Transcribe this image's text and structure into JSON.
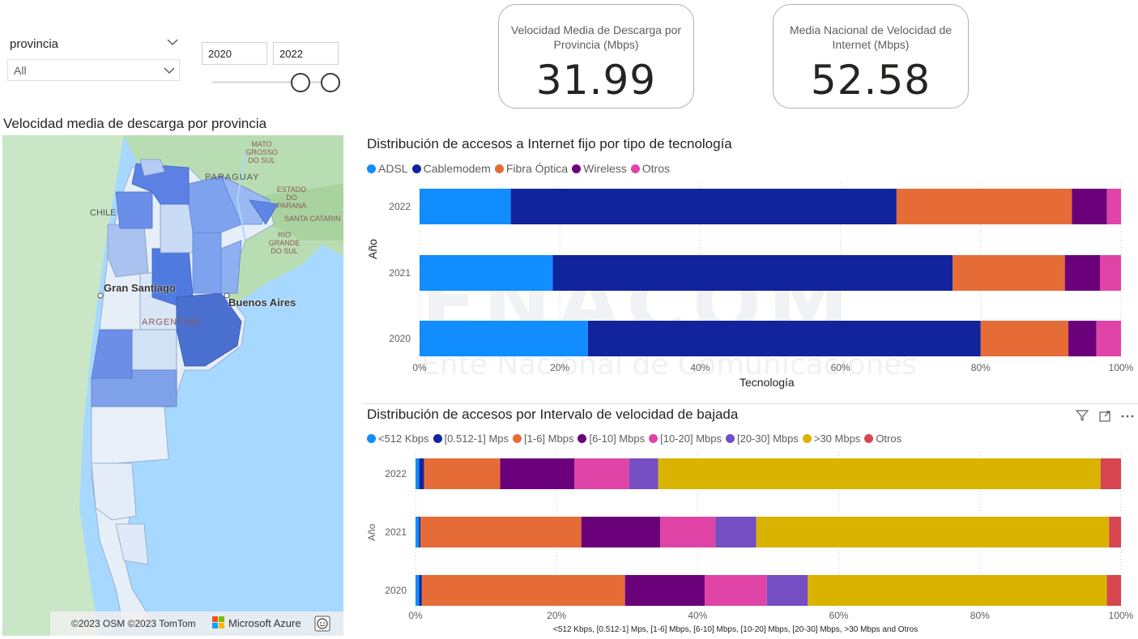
{
  "slicer": {
    "title": "provincia",
    "selected": "All",
    "date_from": "2020",
    "date_to": "2022"
  },
  "cards": [
    {
      "label": "Velocidad Media de Descarga por Provincia (Mbps)",
      "value": "31.99"
    },
    {
      "label": "Media Nacional de Velocidad de Internet (Mbps)",
      "value": "52.58"
    }
  ],
  "map": {
    "title": "Velocidad media de descarga por provincia",
    "labels": {
      "chile": "CHILE",
      "paraguay": "PARAGUAY",
      "gran_santiago": "Gran Santiago",
      "buenos_aires": "Buenos Aires",
      "argentina": "ARGENTINA",
      "grosso": "MATO GROSSO DO SUL",
      "parana": "ESTADO DO PARANÁ",
      "santa_catarina": "SANTA CATARIN",
      "rio_grande": "RIO GRANDE DO SUL"
    },
    "attribution": "©2023 OSM  ©2023 TomTom",
    "brand": "Microsoft Azure"
  },
  "watermark": {
    "line1": "ENACOM",
    "line2": "Ente Nacional de Comunicaciones"
  },
  "chart_data": [
    {
      "type": "bar",
      "orientation": "horizontal-stacked-100",
      "title": "Distribución de accesos a Internet fijo por tipo de tecnología",
      "xlabel": "Tecnología",
      "ylabel": "Año",
      "categories": [
        "2022",
        "2021",
        "2020"
      ],
      "x_ticks": [
        "0%",
        "20%",
        "40%",
        "60%",
        "80%",
        "100%"
      ],
      "series": [
        {
          "name": "ADSL",
          "color": "#118DFF",
          "values": [
            13,
            19,
            24
          ]
        },
        {
          "name": "Cablemodem",
          "color": "#12239E",
          "values": [
            55,
            57,
            56
          ]
        },
        {
          "name": "Fibra Óptica",
          "color": "#E66C37",
          "values": [
            25,
            16,
            12.5
          ]
        },
        {
          "name": "Wireless",
          "color": "#6B007B",
          "values": [
            5,
            5,
            4
          ]
        },
        {
          "name": "Otros",
          "color": "#E044A7",
          "values": [
            2,
            3,
            3.5
          ]
        }
      ]
    },
    {
      "type": "bar",
      "orientation": "horizontal-stacked-100",
      "title": "Distribución de accesos por Intervalo de velocidad de bajada",
      "xlabel": "<512 Kbps, [0.512-1] Mps, [1-6] Mbps, [6-10] Mbps, [10-20] Mbps, [20-30] Mbps, >30 Mbps and Otros",
      "ylabel": "Año",
      "categories": [
        "2022",
        "2021",
        "2020"
      ],
      "x_ticks": [
        "0%",
        "20%",
        "40%",
        "60%",
        "80%",
        "100%"
      ],
      "series": [
        {
          "name": "<512 Kbps",
          "color": "#118DFF",
          "values": [
            0.5,
            0.5,
            0.5
          ]
        },
        {
          "name": "[0.512-1] Mps",
          "color": "#12239E",
          "values": [
            0.7,
            0.2,
            0.4
          ]
        },
        {
          "name": "[1-6] Mbps",
          "color": "#E66C37",
          "values": [
            10.8,
            22.8,
            28.8
          ]
        },
        {
          "name": "[6-10] Mbps",
          "color": "#6B007B",
          "values": [
            10.5,
            11.2,
            11.3
          ]
        },
        {
          "name": "[10-20] Mbps",
          "color": "#E044A7",
          "values": [
            7.8,
            7.8,
            8.8
          ]
        },
        {
          "name": "[20-30] Mbps",
          "color": "#744EC2",
          "values": [
            4.1,
            5.8,
            5.8
          ]
        },
        {
          "name": ">30 Mbps",
          "color": "#D9B300",
          "values": [
            62.7,
            50.0,
            42.4
          ]
        },
        {
          "name": "Otros",
          "color": "#D64550",
          "values": [
            2.9,
            1.7,
            2.0
          ]
        }
      ]
    }
  ]
}
